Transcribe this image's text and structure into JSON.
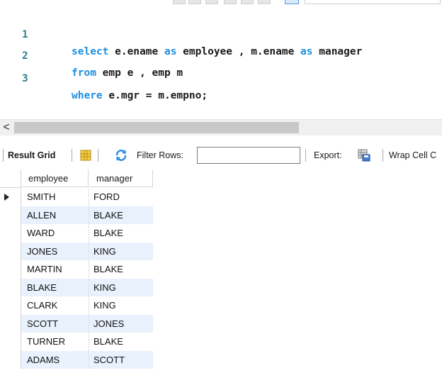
{
  "editor": {
    "lines": [
      {
        "number": "1",
        "parts": [
          {
            "t": "select",
            "kw": true
          },
          {
            "t": " e.ename ",
            "kw": false
          },
          {
            "t": "as",
            "kw": true
          },
          {
            "t": " employee , m.ename ",
            "kw": false
          },
          {
            "t": "as",
            "kw": true
          },
          {
            "t": " manager",
            "kw": false
          }
        ]
      },
      {
        "number": "2",
        "parts": [
          {
            "t": "from",
            "kw": true
          },
          {
            "t": " emp e , emp m",
            "kw": false
          }
        ]
      },
      {
        "number": "3",
        "parts": [
          {
            "t": "where",
            "kw": true
          },
          {
            "t": " e.mgr = m.empno;",
            "kw": false
          }
        ]
      }
    ]
  },
  "scrollbar": {
    "left_arrow": "<"
  },
  "result_toolbar": {
    "result_grid_label": "Result Grid",
    "filter_label": "Filter Rows:",
    "filter_value": "",
    "export_label": "Export:",
    "wrap_label": "Wrap Cell C"
  },
  "grid": {
    "columns": [
      "employee",
      "manager"
    ],
    "rows": [
      [
        "SMITH",
        "FORD"
      ],
      [
        "ALLEN",
        "BLAKE"
      ],
      [
        "WARD",
        "BLAKE"
      ],
      [
        "JONES",
        "KING"
      ],
      [
        "MARTIN",
        "BLAKE"
      ],
      [
        "BLAKE",
        "KING"
      ],
      [
        "CLARK",
        "KING"
      ],
      [
        "SCOTT",
        "JONES"
      ],
      [
        "TURNER",
        "BLAKE"
      ],
      [
        "ADAMS",
        "SCOTT"
      ]
    ],
    "current_row_index": 0
  },
  "colors": {
    "keyword": "#1d8fe0",
    "line_number": "#2b7f8c",
    "alt_row": "#e8f1fc"
  }
}
